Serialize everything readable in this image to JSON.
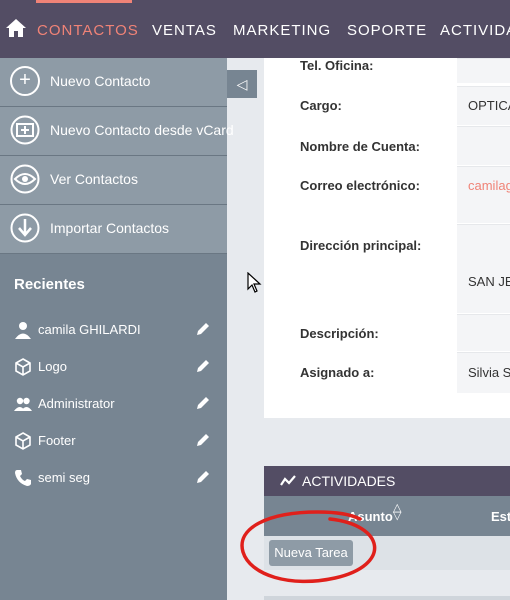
{
  "nav": {
    "items": [
      "CONTACTOS",
      "VENTAS",
      "MARKETING",
      "SOPORTE",
      "ACTIVIDA"
    ]
  },
  "sidebar": {
    "actions": [
      "Nuevo Contacto",
      "Nuevo Contacto desde vCard",
      "Ver Contactos",
      "Importar Contactos"
    ],
    "recent_title": "Recientes",
    "recent": [
      "camila GHILARDI",
      "Logo",
      "Administrator",
      "Footer",
      "semi seg"
    ]
  },
  "detail": {
    "fields": [
      {
        "label": "Tel. Oficina:",
        "value": ""
      },
      {
        "label": "Cargo:",
        "value": "OPTICA"
      },
      {
        "label": "Nombre de Cuenta:",
        "value": ""
      },
      {
        "label": "Correo electrónico:",
        "value": "camilagh"
      },
      {
        "label": "Dirección principal:",
        "value": "SAN JE"
      },
      {
        "label": "Descripción:",
        "value": ""
      },
      {
        "label": "Asignado a:",
        "value": "Silvia S"
      }
    ]
  },
  "activities": {
    "title": "ACTIVIDADES",
    "col_subject": "Asunto",
    "col_status": "Esta",
    "new_task": "Nueva Tarea"
  },
  "colors": {
    "nav_bg": "#534d64",
    "accent": "#f08377",
    "sidebar_bg": "#778592",
    "annotation_red": "#e0201b"
  }
}
